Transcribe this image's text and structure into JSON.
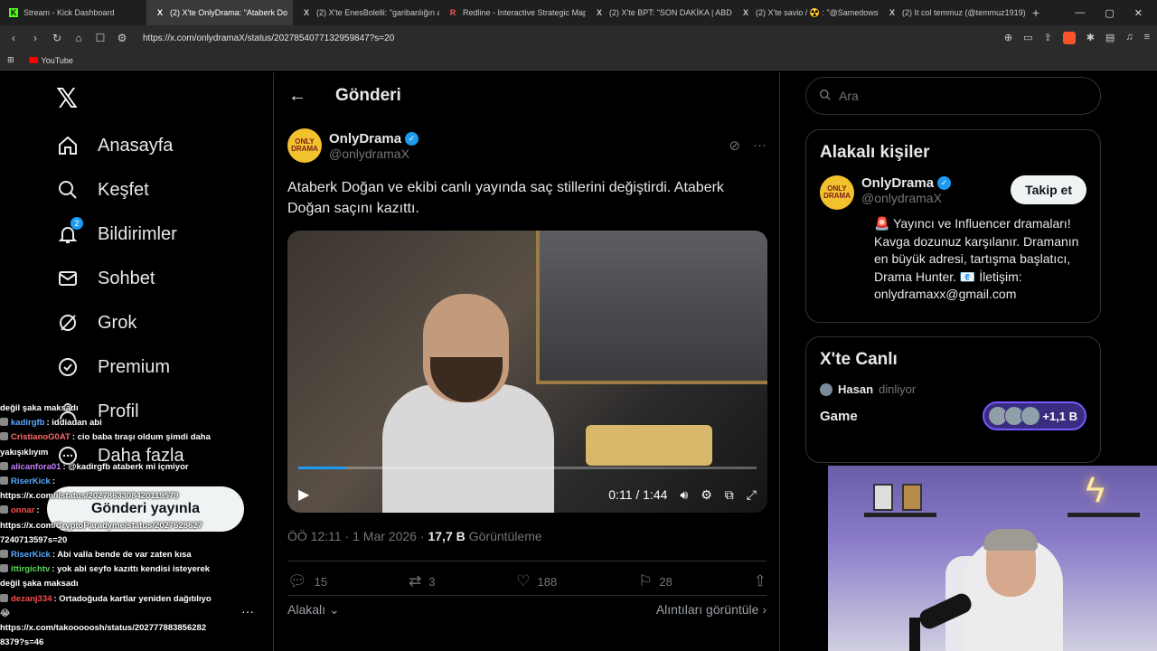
{
  "browser": {
    "tabs": [
      {
        "label": "Stream - Kick Dashboard",
        "icon": "K",
        "active": false
      },
      {
        "label": "(2) X'te OnlyDrama: \"Ataberk Do",
        "icon": "X",
        "active": true
      },
      {
        "label": "(2) X'te EnesBolelli: \"garibanlığın an",
        "icon": "X",
        "active": false
      },
      {
        "label": "Redline - Interactive Strategic Map",
        "icon": "R",
        "active": false
      },
      {
        "label": "(2) X'te BPT: \"SON DAKİKA | ABD Ba",
        "icon": "X",
        "active": false
      },
      {
        "label": "(2) X'te savio / ☢️ : \"@Samedowsk",
        "icon": "X",
        "active": false
      },
      {
        "label": "(2) It col temmuz (@temmuz1919) /",
        "icon": "X",
        "active": false
      }
    ],
    "url": "https://x.com/onlydramaX/status/2027854077132959847?s=20",
    "bookmarks": {
      "youtube": "YouTube"
    }
  },
  "nav": {
    "home": "Anasayfa",
    "explore": "Keşfet",
    "notifications": "Bildirimler",
    "notifications_count": "2",
    "chat": "Sohbet",
    "grok": "Grok",
    "premium": "Premium",
    "profile": "Profil",
    "more": "Daha fazla",
    "post_button": "Gönderi yayınla"
  },
  "post": {
    "header": "Gönderi",
    "author_name": "OnlyDrama",
    "author_handle": "@onlydramaX",
    "avatar_text": "ONLY DRAMA",
    "text": "Ataberk Doğan ve ekibi canlı yayında saç stillerini değiştirdi. Ataberk Doğan saçını kazıttı.",
    "video": {
      "time": "0:11 / 1:44",
      "progress": 0.105
    },
    "time": "ÖÖ 12:11 · 1 Mar 2026 ·",
    "views": "17,7 B",
    "views_label": "Görüntüleme",
    "replies": "15",
    "reposts": "3",
    "likes": "188",
    "bookmarks": "28",
    "related_label": "Alakalı",
    "quotes_label": "Alıntıları görüntüle"
  },
  "right": {
    "search_placeholder": "Ara",
    "related_people_title": "Alakalı kişiler",
    "person_name": "OnlyDrama",
    "person_handle": "@onlydramaX",
    "follow_label": "Takip et",
    "bio": "🚨 Yayıncı ve Influencer dramaları! Kavga dozunuz karşılanır. Dramanın en büyük adresi, tartışma başlatıcı, Drama Hunter. 📧 İletişim: onlydramaxx@gmail.com",
    "live_title": "X'te Canlı",
    "live_host": "Hasan",
    "live_host_status": "dinliyor",
    "space_title": "Game",
    "listeners": "+1,1 B"
  },
  "chat": [
    {
      "user": "",
      "text": "değil şaka maksadı",
      "color": "#ffffff"
    },
    {
      "user": "kadirgfb",
      "text": ": iddiadan abi",
      "color": "#5aa9ff"
    },
    {
      "user": "CristianoG0AT",
      "text": ": cio baba tıraşı oldum şimdi daha",
      "color": "#ff6b6b"
    },
    {
      "user": "",
      "text": "yakışıklıyım",
      "color": "#ffffff"
    },
    {
      "user": "alicanfora01",
      "text": ": @kadirgfb ataberk mi içmiyor",
      "color": "#c77dff"
    },
    {
      "user": "RiserKick",
      "text": ":",
      "color": "#5aa9ff"
    },
    {
      "user": "",
      "text": "https://x.com/i/status/2027863308420119579",
      "color": "#ffffff"
    },
    {
      "user": "onnar",
      "text": ":",
      "color": "#ff4d4d"
    },
    {
      "user": "",
      "text": "https://x.com/CryptoParadyme/status/2027628627",
      "color": "#ffffff"
    },
    {
      "user": "",
      "text": "7240713597s=20",
      "color": "#ffffff"
    },
    {
      "user": "RiserKick",
      "text": ": Abi valla bende de var zaten kısa",
      "color": "#5aa9ff"
    },
    {
      "user": "ittirgichtv",
      "text": ": yok abi seyfo kazıttı kendisi isteyerek",
      "color": "#5bd75b"
    },
    {
      "user": "",
      "text": "değil şaka maksadı",
      "color": "#ffffff"
    },
    {
      "user": "dezanj334",
      "text": ": Ortadoğuda kartlar yeniden dağıtılıyo",
      "color": "#ff4d4d"
    },
    {
      "user": "",
      "text": "😂",
      "color": "#ffffff"
    },
    {
      "user": "",
      "text": "https://x.com/takooooosh/status/2027778838562​82",
      "color": "#ffffff"
    },
    {
      "user": "",
      "text": "8379?s=46",
      "color": "#ffffff"
    }
  ]
}
